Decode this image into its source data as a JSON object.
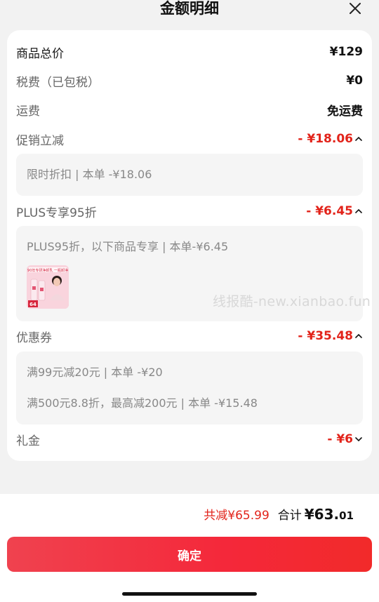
{
  "header": {
    "title": "金额明细"
  },
  "rows": {
    "total_price": {
      "label": "商品总价",
      "value": "¥129"
    },
    "tax": {
      "label": "税费（已包税）",
      "value": "¥0"
    },
    "shipping": {
      "label": "运费",
      "value": "免运费"
    },
    "promo": {
      "label": "促销立减",
      "value": "- ¥18.06",
      "detail": "限时折扣 | 本单 -¥18.06"
    },
    "plus": {
      "label": "PLUS专享95折",
      "value": "- ¥6.45",
      "detail": "PLUS95折，以下商品专享 | 本单-¥6.45"
    },
    "coupon": {
      "label": "优惠券",
      "value": "- ¥35.48",
      "details": [
        "满99元减20元 | 本单 -¥20",
        "满500元8.8折，最高减200元 | 本单 -¥15.48"
      ]
    },
    "gift": {
      "label": "礼金",
      "value": "- ¥6"
    }
  },
  "product_thumb": {
    "badge": "64",
    "headline": "90年专研净卸乳 一瓶卸净"
  },
  "watermark": "线报酷-new.xianbao.fun",
  "footer": {
    "saved": "共减¥65.99",
    "sum_label": "合计",
    "sum_int": "¥63.",
    "sum_dec": "01",
    "confirm_label": "确定"
  },
  "colors": {
    "accent": "#e2231a",
    "button": "#f4283a"
  },
  "icons": {
    "close": "close-icon",
    "chev_up": "chevron-up-icon",
    "chev_down": "chevron-down-icon"
  }
}
